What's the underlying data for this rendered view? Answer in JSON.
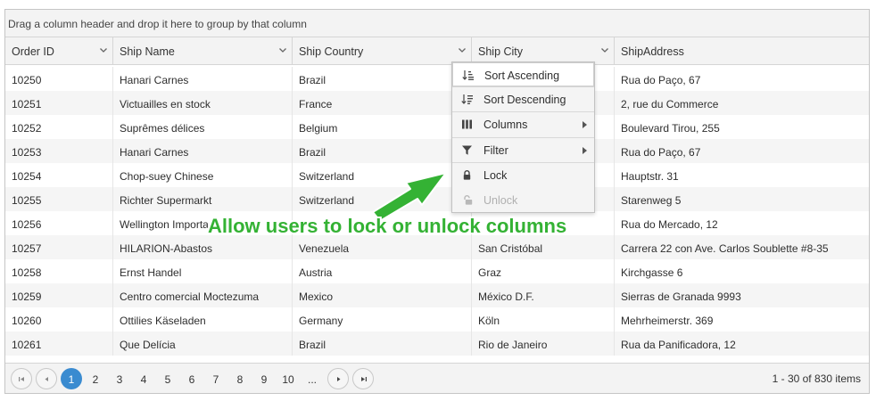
{
  "group_bar": {
    "hint": "Drag a column header and drop it here to group by that column"
  },
  "columns": [
    {
      "label": "Order ID",
      "has_menu": true
    },
    {
      "label": "Ship Name",
      "has_menu": true
    },
    {
      "label": "Ship Country",
      "has_menu": true
    },
    {
      "label": "Ship City",
      "has_menu": true
    },
    {
      "label": "ShipAddress",
      "has_menu": false
    }
  ],
  "rows": [
    {
      "order_id": "10250",
      "ship_name": "Hanari Carnes",
      "ship_country": "Brazil",
      "ship_city": "",
      "ship_address": "Rua do Paço, 67"
    },
    {
      "order_id": "10251",
      "ship_name": "Victuailles en stock",
      "ship_country": "France",
      "ship_city": "",
      "ship_address": "2, rue du Commerce"
    },
    {
      "order_id": "10252",
      "ship_name": "Suprêmes délices",
      "ship_country": "Belgium",
      "ship_city": "",
      "ship_address": "Boulevard Tirou, 255"
    },
    {
      "order_id": "10253",
      "ship_name": "Hanari Carnes",
      "ship_country": "Brazil",
      "ship_city": "",
      "ship_address": "Rua do Paço, 67"
    },
    {
      "order_id": "10254",
      "ship_name": "Chop-suey Chinese",
      "ship_country": "Switzerland",
      "ship_city": "",
      "ship_address": "Hauptstr. 31"
    },
    {
      "order_id": "10255",
      "ship_name": "Richter Supermarkt",
      "ship_country": "Switzerland",
      "ship_city": "",
      "ship_address": "Starenweg 5"
    },
    {
      "order_id": "10256",
      "ship_name": "Wellington Importa",
      "ship_country": "",
      "ship_city": "",
      "ship_address": "Rua do Mercado, 12"
    },
    {
      "order_id": "10257",
      "ship_name": "HILARION-Abastos",
      "ship_country": "Venezuela",
      "ship_city": "San Cristóbal",
      "ship_address": "Carrera 22 con Ave. Carlos Soublette #8-35"
    },
    {
      "order_id": "10258",
      "ship_name": "Ernst Handel",
      "ship_country": "Austria",
      "ship_city": "Graz",
      "ship_address": "Kirchgasse 6"
    },
    {
      "order_id": "10259",
      "ship_name": "Centro comercial Moctezuma",
      "ship_country": "Mexico",
      "ship_city": "México D.F.",
      "ship_address": "Sierras de Granada 9993"
    },
    {
      "order_id": "10260",
      "ship_name": "Ottilies Käseladen",
      "ship_country": "Germany",
      "ship_city": "Köln",
      "ship_address": "Mehrheimerstr. 369"
    },
    {
      "order_id": "10261",
      "ship_name": "Que Delícia",
      "ship_country": "Brazil",
      "ship_city": "Rio de Janeiro",
      "ship_address": "Rua da Panificadora, 12"
    }
  ],
  "column_menu": {
    "sort_ascending": "Sort Ascending",
    "sort_descending": "Sort Descending",
    "columns": "Columns",
    "filter": "Filter",
    "lock": "Lock",
    "unlock": "Unlock"
  },
  "pager": {
    "pages": [
      "1",
      "2",
      "3",
      "4",
      "5",
      "6",
      "7",
      "8",
      "9",
      "10",
      "..."
    ],
    "current_page": "1",
    "info": "1 - 30 of 830 items"
  },
  "callout": {
    "text": "Allow users to lock or unlock columns",
    "color": "#34b234"
  },
  "colors": {
    "accent": "#3a8bd0",
    "header_bg": "#f3f3f3",
    "alt_row_bg": "#f5f5f5"
  }
}
